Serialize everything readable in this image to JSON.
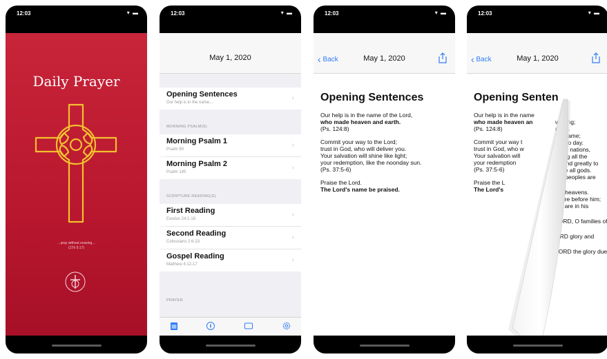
{
  "status": {
    "time": "12:03",
    "signal": "▾ ▬"
  },
  "screen1": {
    "title": "Daily Prayer",
    "verse_line1": "…pray without ceasing…",
    "verse_line2": "(1Th 5:17)"
  },
  "screen2": {
    "nav_title": "May 1, 2020",
    "items": [
      {
        "title": "Opening Sentences",
        "subtitle": "Our help is in the name…"
      },
      {
        "title": "Morning Psalm 1",
        "subtitle": "Psalm 90"
      },
      {
        "title": "Morning Psalm 2",
        "subtitle": "Psalm 145"
      },
      {
        "title": "First Reading",
        "subtitle": "Exodus 24:1-18"
      },
      {
        "title": "Second Reading",
        "subtitle": "Colossians 2:6-23"
      },
      {
        "title": "Gospel Reading",
        "subtitle": "Matthew 4:12-17"
      }
    ],
    "sections": [
      "MORNING PSALM(S)",
      "SCRIPTURE READING(S)",
      "PRAYER"
    ],
    "chevron": "›"
  },
  "screen3": {
    "back_label": "Back",
    "back_chevron": "‹",
    "nav_title": "May 1, 2020",
    "heading": "Opening Sentences",
    "p1_line": "Our help is in the name of the Lord,",
    "p1_bold": "who made heaven and earth.",
    "p1_ref": "(Ps. 124:8)",
    "p2_l1": "Commit your way to the Lord;",
    "p2_l2": "trust in God, who will deliver you.",
    "p2_l3": "Your salvation will shine like light;",
    "p2_l4": "your redemption, like the noonday sun.",
    "p2_ref": "(Ps. 37:5-6)",
    "p3_l1": "Praise the Lord.",
    "p3_bold": "The Lord's name be praised."
  },
  "screen4": {
    "back_label": "Back",
    "back_chevron": "‹",
    "nav_title": "May 1, 2020",
    "heading": "Opening Senten",
    "left_lines": [
      "Our help is in the name",
      "who made heaven an",
      "(Ps. 124:8)",
      "Commit your way t",
      "trust in God, who w",
      "Your salvation will",
      "your redemption",
      "(Ps. 37:5-6)",
      "Praise the L",
      "The Lord's"
    ],
    "right_lines": [
      "w song;",
      "earth.",
      "his name;",
      "day to day.",
      "g the nations,",
      "mong all the",
      "D, and greatly to",
      "bove all gods.",
      "the peoples are",
      "the heavens.",
      "ty are before him;",
      "uty are in his",
      "LORD, O families of",
      "ORD glory and",
      "LORD the glory due"
    ]
  },
  "colors": {
    "crimson": "#c8243a",
    "gold": "#f2c12e",
    "link_blue": "#2f7cf6"
  }
}
